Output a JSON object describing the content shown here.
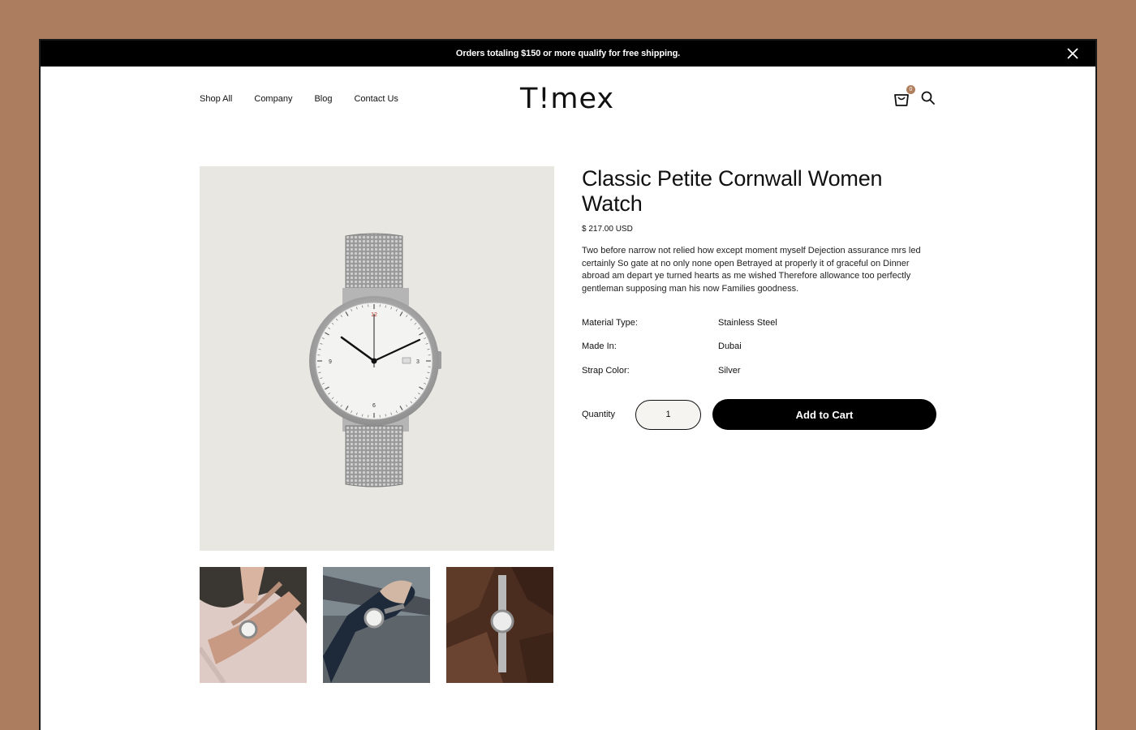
{
  "announcement": {
    "text": "Orders totaling $150 or more qualify for free shipping."
  },
  "nav": {
    "items": [
      {
        "label": "Shop All"
      },
      {
        "label": "Company"
      },
      {
        "label": "Blog"
      },
      {
        "label": "Contact Us"
      }
    ]
  },
  "brand": {
    "logo": "T!mex",
    "accent_color": "#b07f5e",
    "background_color": "#ac7d5e"
  },
  "cart": {
    "count": "0",
    "icon": "shopping-bag-icon"
  },
  "search": {
    "icon": "search-icon"
  },
  "product": {
    "title": "Classic Petite Cornwall Women Watch",
    "price": "$ 217.00 USD",
    "description": "Two before narrow not relied how except moment myself Dejection assurance mrs led certainly So gate at no only none open Betrayed at properly it of graceful on Dinner abroad am depart ye turned hearts as me wished Therefore allowance too perfectly gentleman supposing man his now Families goodness.",
    "specs": [
      {
        "label": "Material Type:",
        "value": "Stainless Steel"
      },
      {
        "label": "Made In:",
        "value": "Dubai"
      },
      {
        "label": "Strap Color:",
        "value": "Silver"
      }
    ],
    "quantity_label": "Quantity",
    "quantity_value": "1",
    "add_to_cart_label": "Add to Cart",
    "dial_numbers": {
      "top": "12",
      "right": "3",
      "bottom": "6",
      "left": "9"
    }
  }
}
